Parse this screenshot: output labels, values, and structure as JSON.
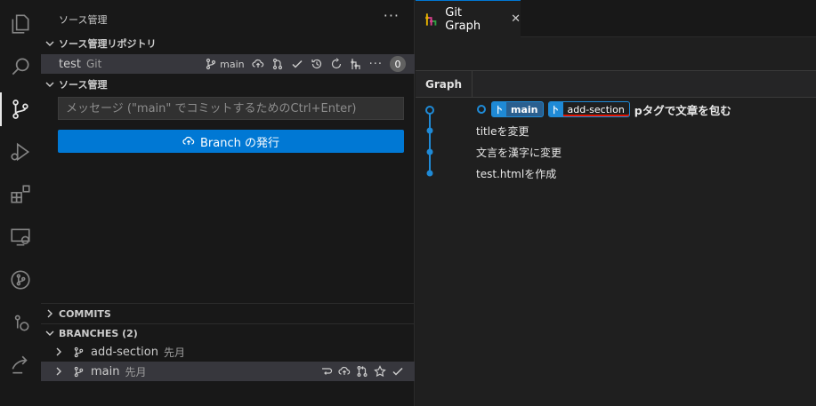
{
  "sidebar": {
    "title": "ソース管理",
    "sections": {
      "repositories": "ソース管理リポジトリ",
      "scm": "ソース管理",
      "commits": "COMMITS",
      "branches": "BRANCHES (2)"
    },
    "repo": {
      "name": "test",
      "type": "Git",
      "branch": "main",
      "badge": "0"
    },
    "commit_input_placeholder": "メッセージ (\"main\" でコミットするためのCtrl+Enter)",
    "publish_button": "Branch の発行",
    "branch_list": [
      {
        "name": "add-section",
        "date": "先月"
      },
      {
        "name": "main",
        "date": "先月"
      }
    ]
  },
  "editor": {
    "tab_label": "Git Graph",
    "tab_close": "✕",
    "graph_column": "Graph",
    "commits": [
      {
        "message": "pタグで文章を包む",
        "refs": [
          "main",
          "add-section"
        ]
      },
      {
        "message": "titleを変更",
        "refs": []
      },
      {
        "message": "文言を漢字に変更",
        "refs": []
      },
      {
        "message": "test.htmlを作成",
        "refs": []
      }
    ]
  },
  "colors": {
    "accent": "#0078d4",
    "graph_line": "#1f8ad6",
    "highlight": "#e51400"
  }
}
